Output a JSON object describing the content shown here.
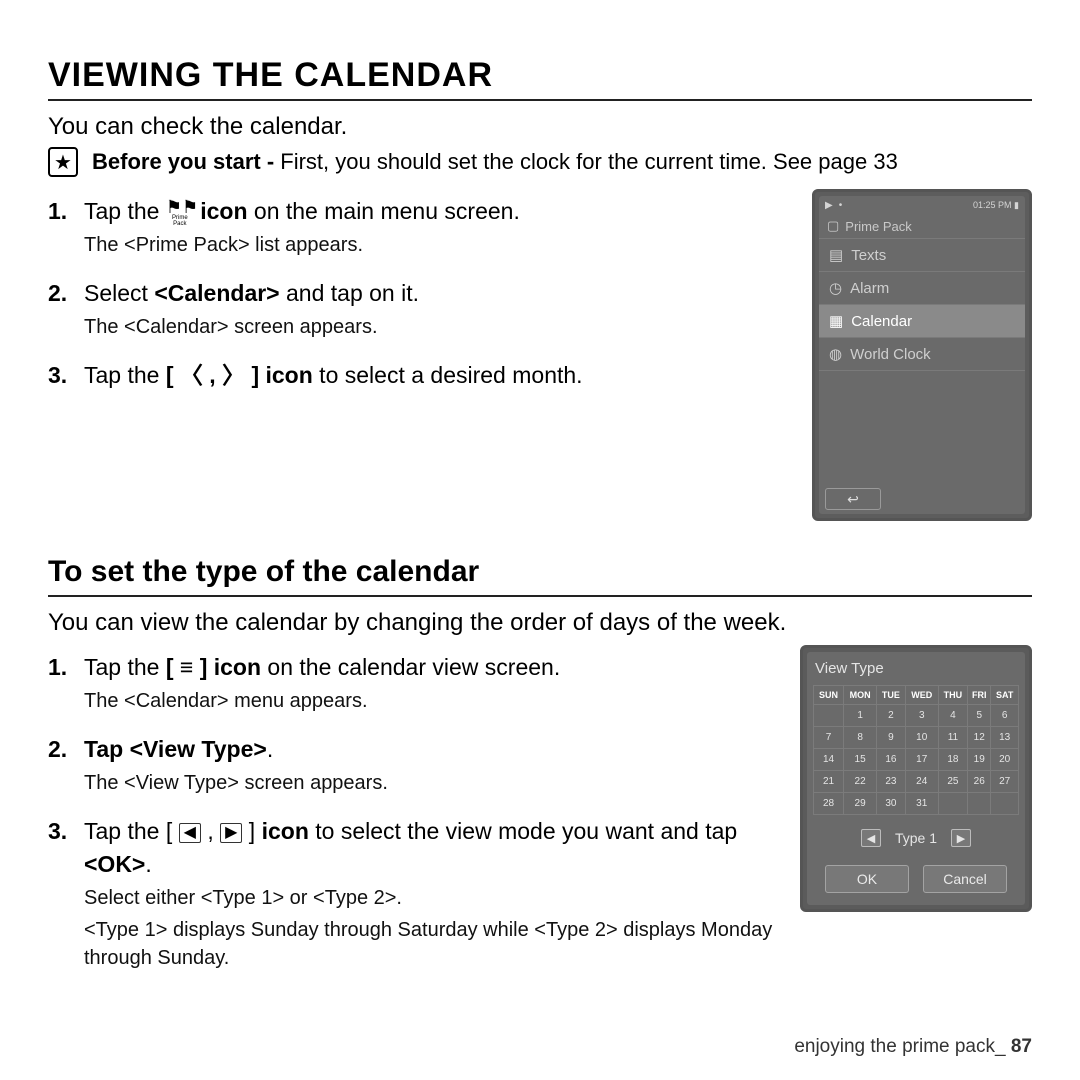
{
  "title": "VIEWING THE CALENDAR",
  "intro": "You can check the calendar.",
  "before": {
    "lead": "Before you start -",
    "text": " First, you should set the clock for the current time. See page 33"
  },
  "steps1": {
    "s1a": "Tap the ",
    "s1b_icon_caption": "Prime Pack",
    "s1c": " icon",
    "s1d": " on the main menu screen.",
    "s1sub": "The <Prime Pack> list appears.",
    "s2a": "Select ",
    "s2b": "<Calendar>",
    "s2c": " and tap on it.",
    "s2sub": "The <Calendar> screen appears.",
    "s3a": "Tap the ",
    "s3b": "[ 〈 , 〉 ] icon",
    "s3c": " to select a desired month."
  },
  "device1": {
    "time": "01:25 PM",
    "header": "Prime Pack",
    "items": [
      "Texts",
      "Alarm",
      "Calendar",
      "World Clock"
    ],
    "selected_index": 2
  },
  "sub_title": "To set the type of the calendar",
  "intro2": "You can view the calendar by changing the order of days of the week.",
  "steps2": {
    "s1a": "Tap the ",
    "s1b": "[ ≡ ] icon",
    "s1c": " on the calendar view screen.",
    "s1sub": "The <Calendar> menu appears.",
    "s2a": "Tap ",
    "s2b": "<View Type>",
    "s2c": ".",
    "s2sub": "The <View Type> screen appears.",
    "s3a": "Tap the ",
    "s3b_pre": "[ ",
    "s3b_post": " ] ",
    "s3c": "icon",
    "s3d": " to select the view mode you want and tap ",
    "s3e": "<OK>",
    "s3f": ".",
    "s3sub1": "Select either <Type 1> or <Type 2>.",
    "s3sub2": "<Type 1> displays Sunday through Saturday while <Type 2> displays Monday through Sunday."
  },
  "device2": {
    "title": "View Type",
    "dow": [
      "SUN",
      "MON",
      "TUE",
      "WED",
      "THU",
      "FRI",
      "SAT"
    ],
    "grid": [
      [
        "",
        "1",
        "2",
        "3",
        "4",
        "5",
        "6"
      ],
      [
        "7",
        "8",
        "9",
        "10",
        "11",
        "12",
        "13"
      ],
      [
        "14",
        "15",
        "16",
        "17",
        "18",
        "19",
        "20"
      ],
      [
        "21",
        "22",
        "23",
        "24",
        "25",
        "26",
        "27"
      ],
      [
        "28",
        "29",
        "30",
        "31",
        "",
        "",
        ""
      ]
    ],
    "type_label": "Type 1",
    "ok": "OK",
    "cancel": "Cancel"
  },
  "footer": {
    "chapter": "enjoying the prime pack_",
    "page": "87"
  }
}
